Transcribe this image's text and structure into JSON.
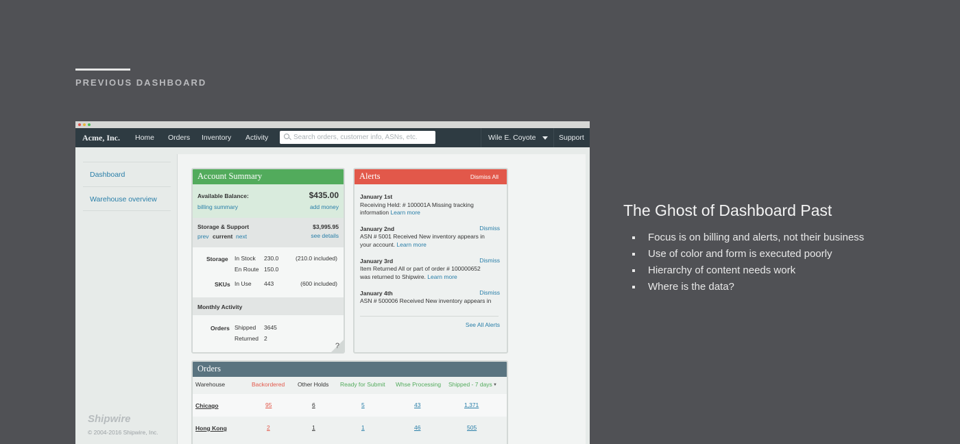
{
  "section_title": "PREVIOUS DASHBOARD",
  "app": {
    "brand": "Acme, Inc.",
    "nav": [
      "Home",
      "Orders",
      "Inventory",
      "Activity"
    ],
    "search_placeholder": "Search orders, customer info, ASNs, etc.",
    "user": "Wile E. Coyote",
    "support": "Support"
  },
  "sidebar": {
    "items": [
      "Dashboard",
      "Warehouse overview"
    ],
    "logo": "Shipwire",
    "copyright": "© 2004-2016 Shipwire, Inc."
  },
  "account_summary": {
    "title": "Account Summary",
    "balance_label": "Available Balance:",
    "balance_value": "$435.00",
    "billing_summary": "billing summary",
    "add_money": "add money",
    "storage_label": "Storage & Support",
    "storage_value": "$3,995.95",
    "prev": "prev",
    "current": "current",
    "next": "next",
    "see_details": "see details",
    "storage_head": "Storage",
    "in_stock_label": "In Stock",
    "in_stock_value": "230.0",
    "in_stock_included": "(210.0 included)",
    "en_route_label": "En Route",
    "en_route_value": "150.0",
    "skus_head": "SKUs",
    "in_use_label": "In Use",
    "in_use_value": "443",
    "in_use_included": "(600 included)",
    "monthly_activity": "Monthly Activity",
    "orders_head": "Orders",
    "shipped_label": "Shipped",
    "shipped_value": "3645",
    "returned_label": "Returned",
    "returned_value": "2",
    "help": "?"
  },
  "alerts": {
    "title": "Alerts",
    "dismiss_all": "Dismiss All",
    "dismiss": "Dismiss",
    "learn_more": "Learn more",
    "see_all": "See All Alerts",
    "items": [
      {
        "date": "January 1st",
        "line1": "Receiving Held: # 100001A Missing tracking",
        "line2": "information"
      },
      {
        "date": "January 2nd",
        "line1": "ASN # 5001 Received New inventory appears in",
        "line2": "your account."
      },
      {
        "date": "January 3rd",
        "line1": "Item Returned All or part of order # 100000652",
        "line2": "was returned to Shipwire."
      },
      {
        "date": "January 4th",
        "line1": "ASN # 500006 Received New inventory appears in",
        "line2": ""
      }
    ]
  },
  "orders": {
    "title": "Orders",
    "columns": [
      "Warehouse",
      "Backordered",
      "Other Holds",
      "Ready for Submit",
      "Whse Processing",
      "Shipped - 7 days"
    ],
    "rows": [
      {
        "warehouse": "Chicago",
        "backordered": "95",
        "other_holds": "6",
        "ready": "5",
        "processing": "43",
        "shipped": "1,371"
      },
      {
        "warehouse": "Hong Kong",
        "backordered": "2",
        "other_holds": "1",
        "ready": "1",
        "processing": "46",
        "shipped": "505"
      }
    ]
  },
  "right_panel": {
    "title": "The Ghost of Dashboard Past",
    "bullets": [
      "Focus is on billing and alerts, not their business",
      "Use of color and form is executed poorly",
      "Hierarchy of content needs work",
      "Where is the data?"
    ]
  }
}
